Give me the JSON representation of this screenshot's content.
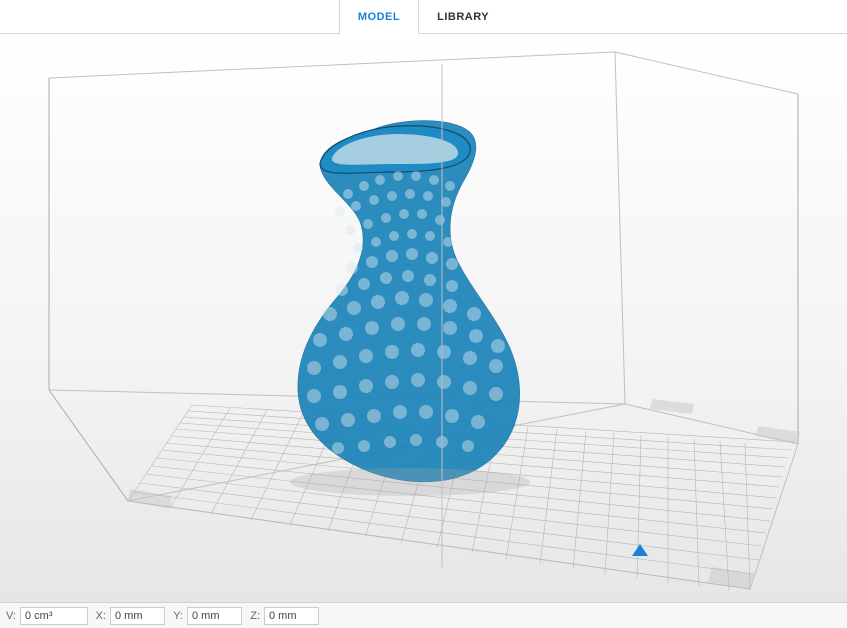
{
  "tabs": {
    "model": "MODEL",
    "library": "LIBRARY",
    "active": "model"
  },
  "dimensions": {
    "volume": {
      "label": "V:",
      "value": "0 cm³"
    },
    "x": {
      "label": "X:",
      "value": "0 mm"
    },
    "y": {
      "label": "Y:",
      "value": "0 mm"
    },
    "z": {
      "label": "Z:",
      "value": "0 mm"
    }
  },
  "model": {
    "accent_color": "#1a82d6",
    "object_color": "#1889bc"
  }
}
